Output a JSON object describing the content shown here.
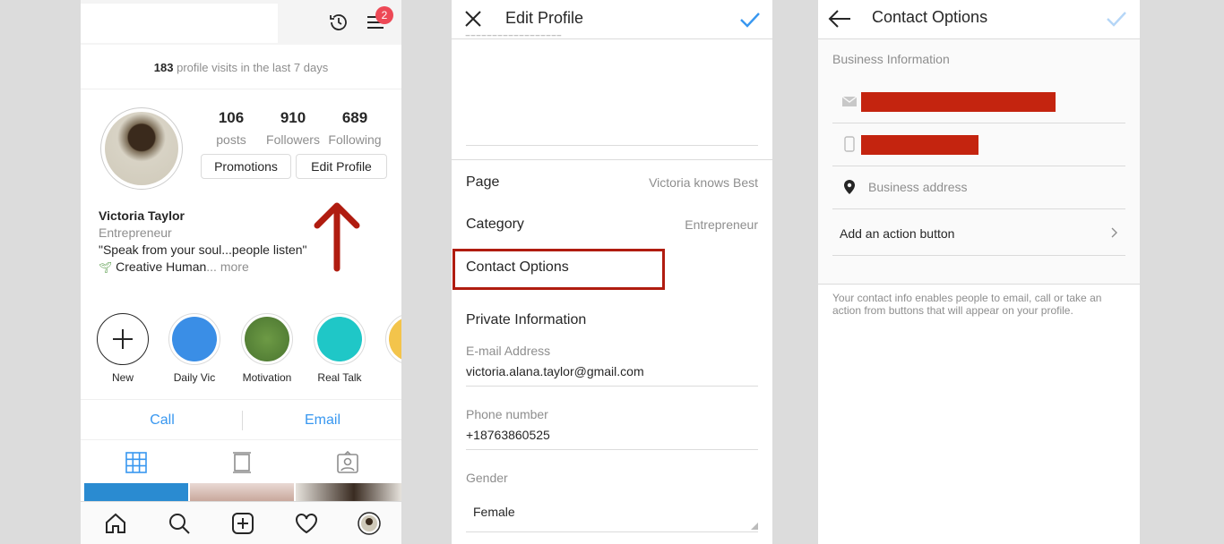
{
  "profile_panel": {
    "notification_count": "2",
    "visits_count": "183",
    "visits_text": " profile visits in the last 7 days",
    "stats": [
      {
        "number": "106",
        "label": "posts"
      },
      {
        "number": "910",
        "label": "Followers"
      },
      {
        "number": "689",
        "label": "Following"
      }
    ],
    "promotions_label": "Promotions",
    "edit_profile_label": "Edit Profile",
    "name": "Victoria Taylor",
    "category": "Entrepreneur",
    "quote": "\"Speak from your soul...people listen\"",
    "bio_line": "Creative Human",
    "bio_more": "... more",
    "highlights": [
      {
        "label": "New",
        "color": "#ffffff"
      },
      {
        "label": "Daily Vic",
        "color": "#3a8ee6"
      },
      {
        "label": "Motivation",
        "color": "#5d8a3a"
      },
      {
        "label": "Real Talk",
        "color": "#1fc7c7"
      },
      {
        "label": "",
        "color": "#f3c44b"
      }
    ],
    "call_label": "Call",
    "email_label": "Email",
    "accent_color": "#3897f0",
    "arrow_color": "#b01c10"
  },
  "edit_panel": {
    "title": "Edit Profile",
    "page_label": "Page",
    "page_value": "Victoria knows Best",
    "category_label": "Category",
    "category_value": "Entrepreneur",
    "contact_options_label": "Contact Options",
    "private_info_label": "Private Information",
    "email_label": "E-mail Address",
    "email_value": "victoria.alana.taylor@gmail.com",
    "phone_label": "Phone number",
    "phone_value": "+18763860525",
    "gender_label": "Gender",
    "gender_value": "Female"
  },
  "contact_panel": {
    "title": "Contact Options",
    "section_label": "Business Information",
    "address_placeholder": "Business address",
    "action_button_label": "Add an action button",
    "note": "Your contact info enables people to email, call or take an action from buttons that will appear on your profile.",
    "redaction_color": "#c4240f"
  }
}
